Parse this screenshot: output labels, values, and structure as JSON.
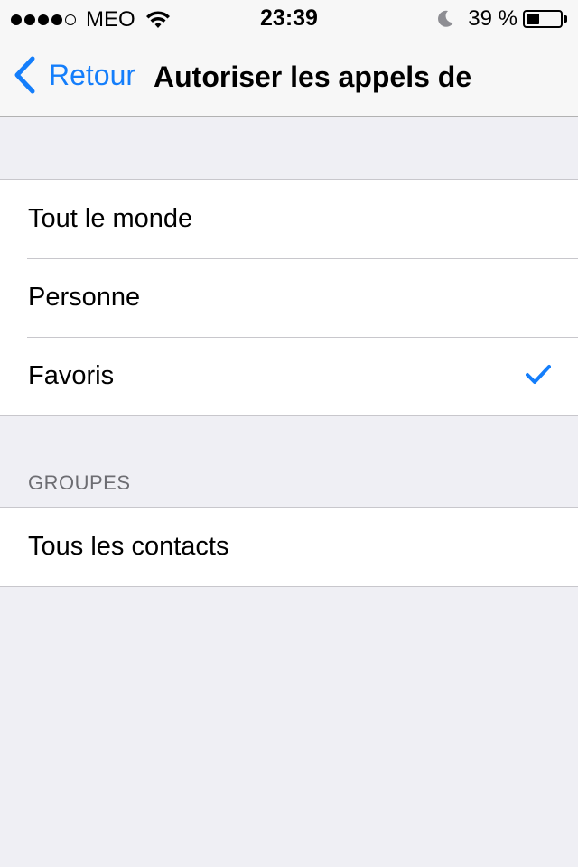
{
  "status_bar": {
    "carrier": "MEO",
    "time": "23:39",
    "battery_percent": "39 %",
    "battery_level": 0.39,
    "signal_bars_filled": 4,
    "signal_bars_total": 5
  },
  "nav": {
    "back_label": "Retour",
    "title": "Autoriser les appels de"
  },
  "options": [
    {
      "label": "Tout le monde",
      "selected": false
    },
    {
      "label": "Personne",
      "selected": false
    },
    {
      "label": "Favoris",
      "selected": true
    }
  ],
  "groups_section": {
    "header": "GROUPES",
    "items": [
      {
        "label": "Tous les contacts"
      }
    ]
  },
  "colors": {
    "accent": "#147efb",
    "background": "#efeff4",
    "separator": "#c8c7cc",
    "section_header": "#6d6d72"
  }
}
